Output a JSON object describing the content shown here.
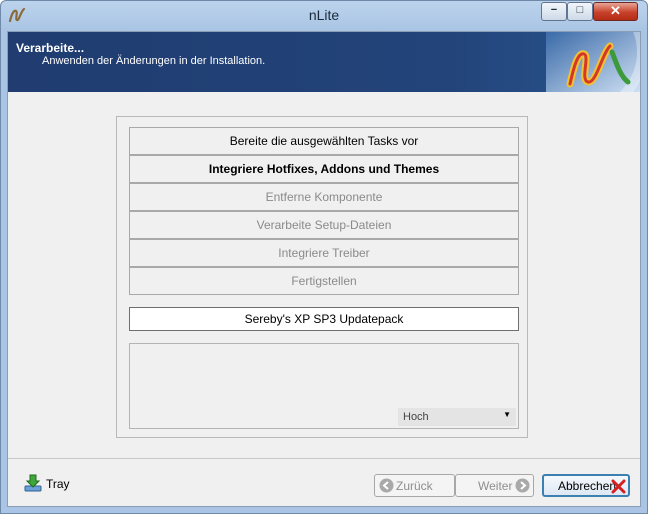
{
  "window": {
    "title": "nLite",
    "controls": {
      "minimize": "−",
      "maximize": "□",
      "close": "✕"
    }
  },
  "header": {
    "title": "Verarbeite...",
    "subtitle": "Anwenden der Änderungen in der Installation.",
    "logo_icon": "nlite-logo-icon"
  },
  "steps": [
    {
      "label": "Bereite die ausgewählten Tasks vor",
      "state": "done"
    },
    {
      "label": "Integriere Hotfixes, Addons und Themes",
      "state": "active"
    },
    {
      "label": "Entferne Komponente",
      "state": "pending"
    },
    {
      "label": "Verarbeite Setup-Dateien",
      "state": "pending"
    },
    {
      "label": "Integriere Treiber",
      "state": "pending"
    },
    {
      "label": "Fertigstellen",
      "state": "pending"
    }
  ],
  "current_item": "Sereby's XP SP3 Updatepack",
  "priority": {
    "selected": "Hoch"
  },
  "footer": {
    "tray_label": "Tray",
    "back_label": "Zurück",
    "next_label": "Weiter",
    "cancel_label": "Abbrechen"
  },
  "colors": {
    "header_bg": "#203c70",
    "cancel_icon": "#d42020",
    "accent_border": "#3c7fb1"
  }
}
